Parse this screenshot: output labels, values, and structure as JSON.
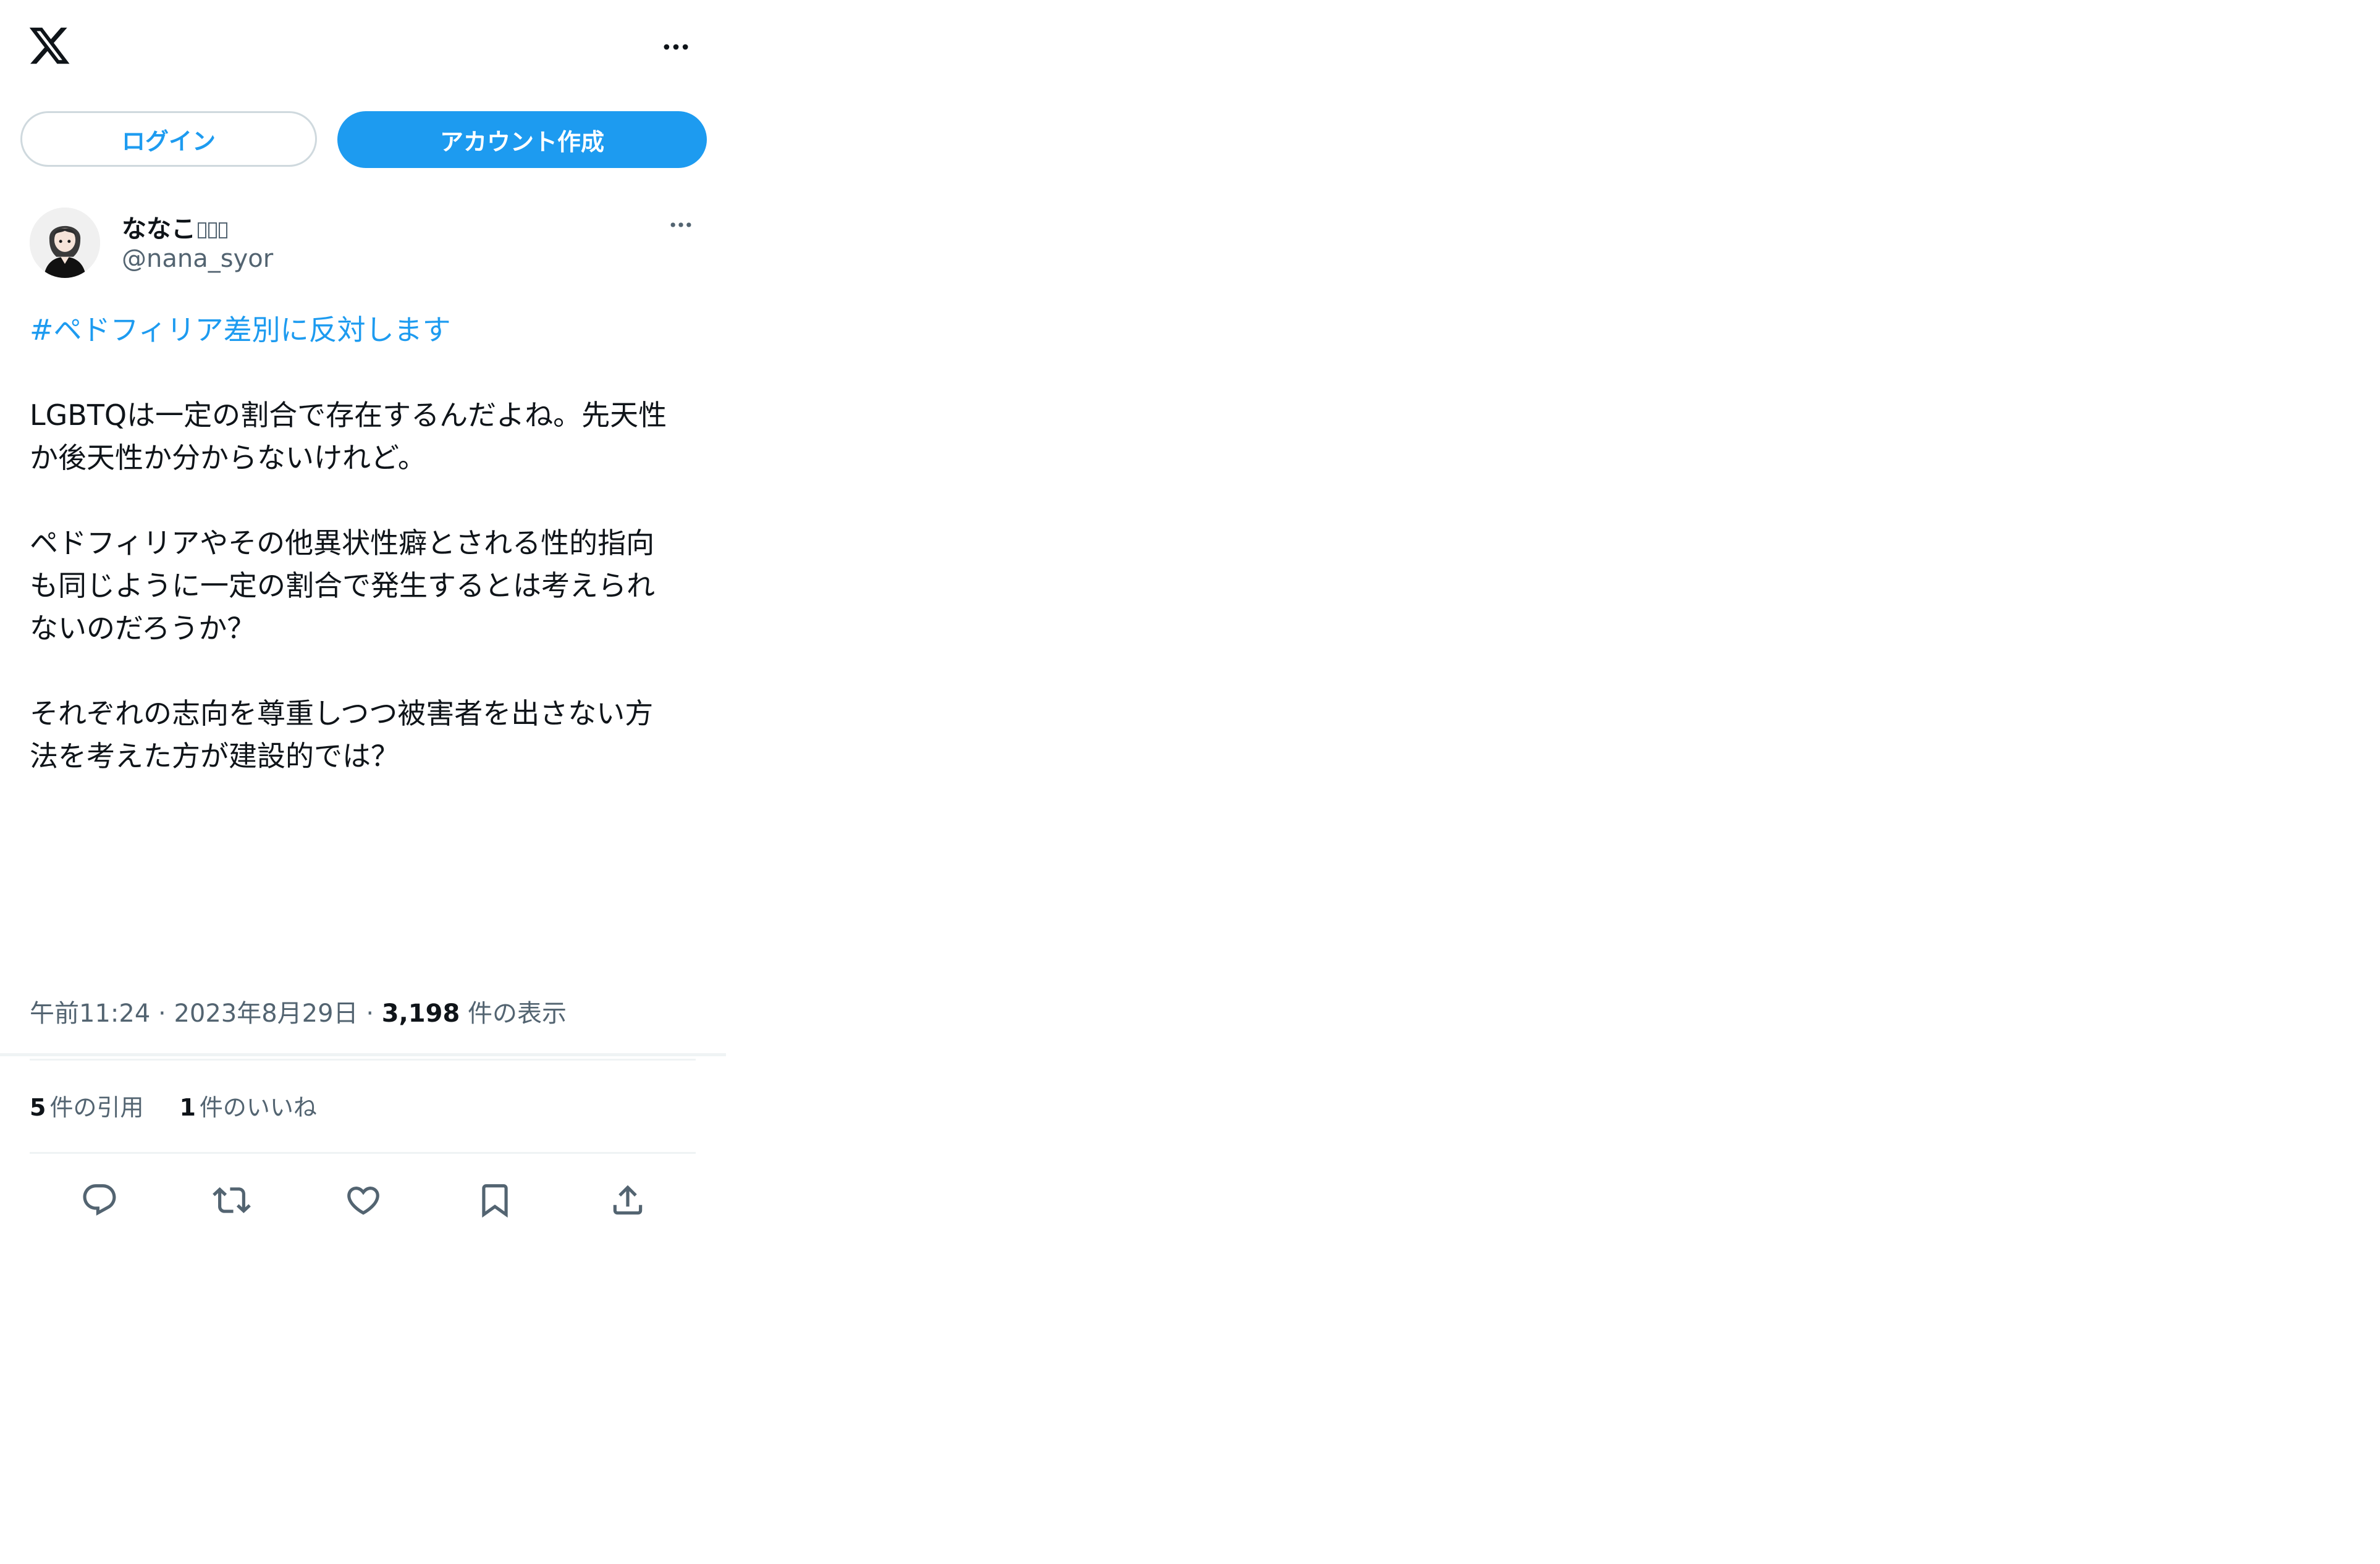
{
  "header": {
    "logo_icon": "x-logo-icon",
    "more_icon": "more-horizontal-icon"
  },
  "auth": {
    "login_label": "ログイン",
    "signup_label": "アカウント作成"
  },
  "tweet": {
    "author": {
      "display_name": "ななこ",
      "username": "@nana_syor",
      "avatar_icon": "avatar-illustration"
    },
    "hashtag": "#ペドフィリア差別に反対します",
    "paragraphs": [
      "LGBTQは一定の割合で存在するんだよね。先天性\nか後天性か分からないけれど。",
      "ペドフィリアやその他異状性癖とされる性的指向\nも同じように一定の割合で発生するとは考えられ\nないのだろうか？",
      "それぞれの志向を尊重しつつ被害者を出さない方\n法を考えた方が建設的では？"
    ],
    "time": "午前11:24",
    "separator": "·",
    "date": "2023年8月29日",
    "views_count": "3,198",
    "views_label": "件の表示",
    "stats": {
      "quotes_count": "5",
      "quotes_label": "件の引用",
      "likes_count": "1",
      "likes_label": "件のいいね"
    },
    "actions": [
      "reply-icon",
      "retweet-icon",
      "like-icon",
      "bookmark-icon",
      "share-icon"
    ]
  },
  "colors": {
    "accent": "#1d9bf0",
    "text_primary": "#0f1419",
    "text_secondary": "#536471",
    "divider": "#eff3f4",
    "outline_button_border": "#cfd9de"
  }
}
